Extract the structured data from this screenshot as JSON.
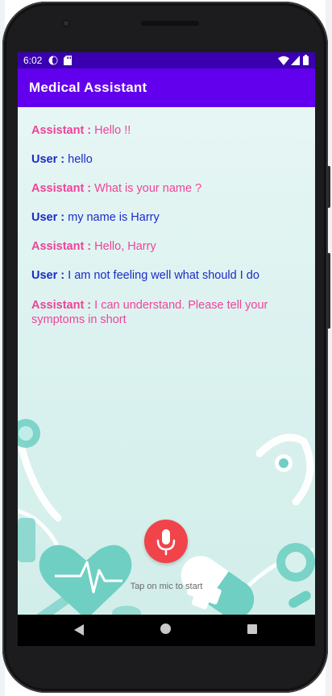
{
  "status_bar": {
    "time": "6:02"
  },
  "app_bar": {
    "title": "Medical Assistant"
  },
  "conversation": [
    {
      "speaker": "Assistant :",
      "text": "Hello !!",
      "role": "assistant"
    },
    {
      "speaker": "User :",
      "text": "hello",
      "role": "user"
    },
    {
      "speaker": "Assistant :",
      "text": "What is your name ?",
      "role": "assistant"
    },
    {
      "speaker": "User :",
      "text": "my name is Harry",
      "role": "user"
    },
    {
      "speaker": "Assistant :",
      "text": "Hello, Harry",
      "role": "assistant"
    },
    {
      "speaker": "User :",
      "text": "I am not feeling well what should I do",
      "role": "user"
    },
    {
      "speaker": "Assistant :",
      "text": "I can understand. Please tell your symptoms in short",
      "role": "assistant"
    }
  ],
  "mic": {
    "icon": "microphone-icon",
    "hint": "Tap on mic to start"
  },
  "nav": {
    "back_icon": "back-icon",
    "home_icon": "home-icon",
    "recent_icon": "recent-apps-icon"
  },
  "colors": {
    "status_bar": "#3a00b0",
    "app_bar": "#6200ee",
    "assistant_text": "#ee4498",
    "user_text": "#1b2bc9",
    "mic_button": "#f0444a",
    "decor_teal": "#6fcfc3"
  }
}
